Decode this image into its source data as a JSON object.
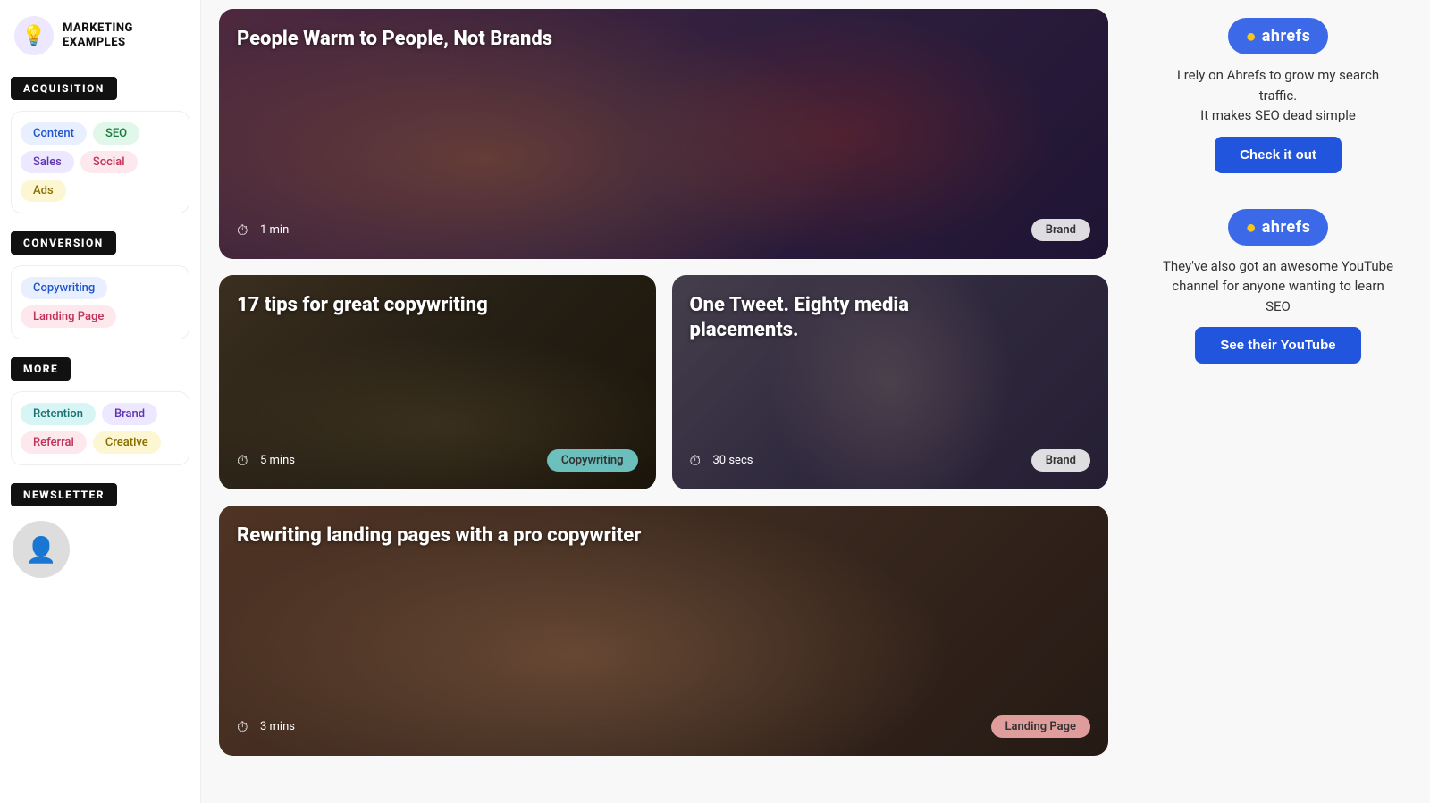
{
  "logo": {
    "icon": "💡",
    "line1": "MARKETING",
    "line2": "EXAMPLES"
  },
  "sidebar": {
    "sections": [
      {
        "label": "ACQUISITION",
        "tags": [
          {
            "text": "Content",
            "color": "blue"
          },
          {
            "text": "SEO",
            "color": "green"
          },
          {
            "text": "Sales",
            "color": "purple"
          },
          {
            "text": "Social",
            "color": "pink"
          },
          {
            "text": "Ads",
            "color": "yellow"
          }
        ]
      },
      {
        "label": "CONVERSION",
        "tags": [
          {
            "text": "Copywriting",
            "color": "blue"
          },
          {
            "text": "Landing Page",
            "color": "pink"
          }
        ]
      },
      {
        "label": "MORE",
        "tags": [
          {
            "text": "Retention",
            "color": "teal"
          },
          {
            "text": "Brand",
            "color": "purple"
          },
          {
            "text": "Referral",
            "color": "pink"
          },
          {
            "text": "Creative",
            "color": "yellow"
          }
        ]
      },
      {
        "label": "NEWSLETTER",
        "tags": []
      }
    ]
  },
  "cards": [
    {
      "title": "People Warm to People, Not Brands",
      "time": "1 min",
      "tag": "Brand",
      "tagStyle": "default",
      "bg": "people"
    },
    {
      "title": "17 tips for great copywriting",
      "time": "5 mins",
      "tag": "Copywriting",
      "tagStyle": "teal",
      "bg": "car"
    },
    {
      "title": "One Tweet. Eighty media placements.",
      "time": "30 secs",
      "tag": "Brand",
      "tagStyle": "default",
      "bg": "tweet"
    },
    {
      "title": "Rewriting landing pages with a pro copywriter",
      "time": "3 mins",
      "tag": "Landing Page",
      "tagStyle": "pink",
      "bg": "landing"
    }
  ],
  "ads": [
    {
      "logo_text": "ahrefs",
      "body": "I rely on Ahrefs to grow my search traffic.\nIt makes SEO dead simple",
      "button": "Check it out"
    },
    {
      "logo_text": "ahrefs",
      "body": "They've also got an awesome YouTube channel for anyone wanting to learn SEO",
      "button": "See their YouTube"
    }
  ],
  "icons": {
    "time": "⏱",
    "logo": "💡"
  }
}
